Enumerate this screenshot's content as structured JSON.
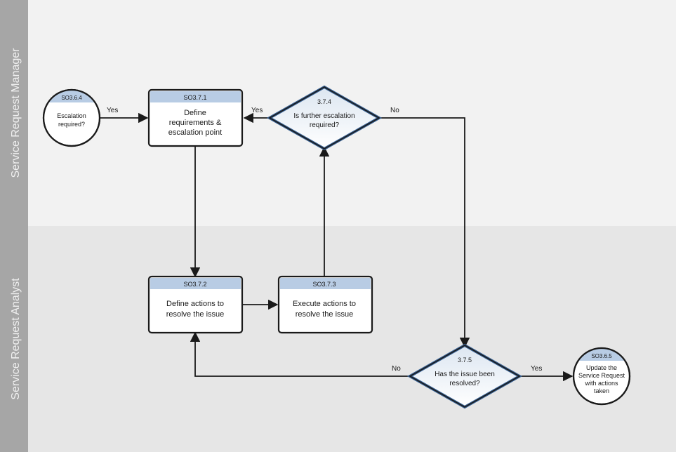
{
  "lanes": {
    "top": "Service Request Manager",
    "bottom": "Service Request Analyst"
  },
  "nodes": {
    "start": {
      "id": "SO3.6.4",
      "text1": "Escalation",
      "text2": "required?"
    },
    "n371": {
      "id": "SO3.7.1",
      "text1": "Define",
      "text2": "requirements &",
      "text3": "escalation point"
    },
    "n374": {
      "id": "3.7.4",
      "text1": "Is further escalation",
      "text2": "required?"
    },
    "n372": {
      "id": "SO3.7.2",
      "text1": "Define actions to",
      "text2": "resolve the issue"
    },
    "n373": {
      "id": "SO3.7.3",
      "text1": "Execute actions to",
      "text2": "resolve the issue"
    },
    "n375": {
      "id": "3.7.5",
      "text1": "Has the issue been",
      "text2": "resolved?"
    },
    "end": {
      "id": "SO3.6.5",
      "text1": "Update the",
      "text2": "Service Request",
      "text3": "with actions",
      "text4": "taken"
    }
  },
  "labels": {
    "yes": "Yes",
    "no": "No"
  },
  "colors": {
    "laneBg1": "#f2f2f2",
    "laneBg2": "#e6e6e6",
    "laneHeader": "#a6a6a6",
    "nodeStroke": "#1a1a1a",
    "nodeHeader": "#b8cce4",
    "nodeFill": "#ffffff",
    "circleHeader": "#b8cce4",
    "diamondStroke": "#365f91"
  }
}
